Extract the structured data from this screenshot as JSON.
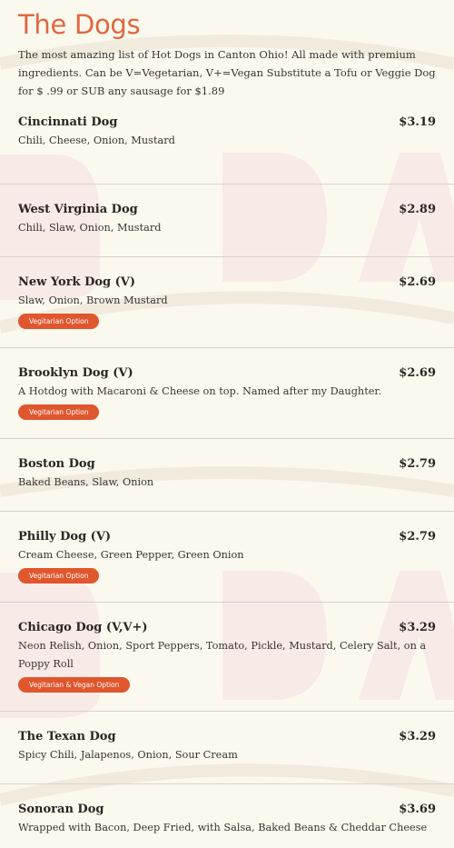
{
  "header": {
    "title": "The Dogs",
    "intro": "The most amazing list of Hot Dogs in Canton Ohio! All made with premium ingredients. Can be V=Vegetarian, V+=Vegan Substitute a Tofu or Veggie Dog for $ .99 or SUB any sausage for $1.89"
  },
  "items": [
    {
      "name": "Cincinnati Dog",
      "price": "$3.19",
      "description": "Chili, Cheese, Onion, Mustard",
      "badge": ""
    },
    {
      "name": "West Virginia Dog",
      "price": "$2.89",
      "description": "Chili, Slaw, Onion, Mustard",
      "badge": ""
    },
    {
      "name": "New York Dog (V)",
      "price": "$2.69",
      "description": "Slaw, Onion, Brown Mustard",
      "badge": "Vegitarian Option"
    },
    {
      "name": "Brooklyn Dog (V)",
      "price": "$2.69",
      "description": "A Hotdog with Macaroni & Cheese on top. Named after my Daughter.",
      "badge": "Vegitarian Option"
    },
    {
      "name": "Boston Dog",
      "price": "$2.79",
      "description": "Baked Beans, Slaw, Onion",
      "badge": ""
    },
    {
      "name": "Philly Dog (V)",
      "price": "$2.79",
      "description": "Cream Cheese, Green Pepper, Green Onion",
      "badge": "Vegitarian Option"
    },
    {
      "name": "Chicago Dog (V,V+)",
      "price": "$3.29",
      "description": "Neon Relish, Onion, Sport Peppers, Tomato, Pickle, Mustard, Celery Salt, on a Poppy Roll",
      "badge": "Vegitarian & Vegan Option"
    },
    {
      "name": "The Texan Dog",
      "price": "$3.29",
      "description": "Spicy Chili, Jalapenos, Onion, Sour Cream",
      "badge": ""
    },
    {
      "name": "Sonoran Dog",
      "price": "$3.69",
      "description": "Wrapped with Bacon, Deep Fried, with Salsa, Baked Beans & Cheddar Cheese",
      "badge": ""
    }
  ],
  "colors": {
    "accent": "#e0673f",
    "badge_bg": "#e0562d",
    "background": "#fbf9ee",
    "divider": "#d9d2c6"
  }
}
